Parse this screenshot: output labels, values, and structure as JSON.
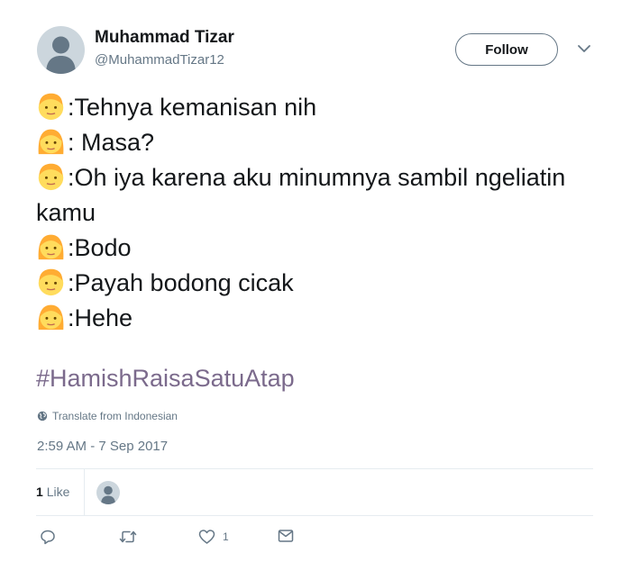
{
  "user": {
    "name": "Muhammad Tizar",
    "handle": "@MuhammadTizar12",
    "avatar_icon": "default-avatar-icon"
  },
  "header": {
    "follow_label": "Follow",
    "caret_icon": "chevron-down-icon"
  },
  "tweet": {
    "lines": [
      {
        "emoji": "boy-emoji",
        "text": ":Tehnya kemanisan nih"
      },
      {
        "emoji": "girl-emoji",
        "text": ": Masa?"
      },
      {
        "emoji": "boy-emoji",
        "text": ":Oh iya karena aku minumnya sambil ngeliatin kamu"
      },
      {
        "emoji": "girl-emoji",
        "text": ":Bodo"
      },
      {
        "emoji": "boy-emoji",
        "text": ":Payah bodong cicak"
      },
      {
        "emoji": "girl-emoji",
        "text": ":Hehe"
      }
    ],
    "hashtag": "#HamishRaisaSatuAtap"
  },
  "translate": {
    "label": "Translate from Indonesian",
    "icon": "globe-icon"
  },
  "timestamp": "2:59 AM - 7 Sep 2017",
  "stats": {
    "likes_number": "1",
    "likes_label": "Like"
  },
  "actions": {
    "reply_icon": "reply-icon",
    "retweet_icon": "retweet-icon",
    "like_icon": "heart-icon",
    "like_count": "1",
    "dm_icon": "envelope-icon"
  },
  "colors": {
    "text": "#14171a",
    "secondary": "#657786",
    "hashtag": "#7b6a8c",
    "divider": "#e6ecf0",
    "emoji_face": "#ffdc5d",
    "emoji_hair": "#ffac33"
  }
}
